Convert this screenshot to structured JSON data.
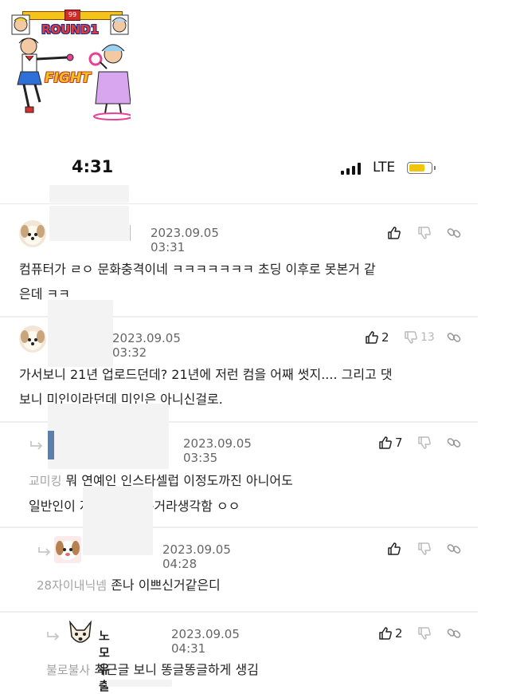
{
  "banner": {
    "round_text": "ROUND1",
    "fight_text": "FIGHT",
    "timer": "99"
  },
  "status_bar": {
    "time": "4:31",
    "network": "LTE"
  },
  "comments": [
    {
      "username": "",
      "date": "2023.09.05 03:31",
      "reply_to": "",
      "text_line1": "컴퓨터가 ㄹㅇ 문화충격이네 ㅋㅋㅋㅋㅋㅋㅋ 초딩 이후로 못본거 같",
      "text_line2": "은데 ㅋㅋ",
      "likes": "",
      "dislikes": ""
    },
    {
      "username": "",
      "date": "2023.09.05 03:32",
      "reply_to": "",
      "text_line1": "가서보니 21년 업로드던데? 21년에 저런 컴을 어째 썻지.... 그리고 댓",
      "text_line2": "보니 미인이라던데 미인은 아니신걸로.",
      "likes": "2",
      "dislikes": "13"
    },
    {
      "username": "",
      "date": "2023.09.05 03:35",
      "reply_to": "교미킹",
      "text_line1": "뭐 연예인 인스타셀럽 이정도까진 아니어도",
      "text_line2": "일반인이 저정도면 예쁜거라생각함 ㅇㅇ",
      "likes": "7",
      "dislikes": ""
    },
    {
      "username": "",
      "date": "2023.09.05 04:28",
      "reply_to": "28자이내닉넴",
      "text_line1": "존나 이쁘신거같은디",
      "text_line2": "",
      "likes": "",
      "dislikes": ""
    },
    {
      "username": "노모유출",
      "date": "2023.09.05 04:31",
      "reply_to": "불로불사",
      "text_line1": "최근글 보니 똥글똥글하게 생김",
      "text_line2": "",
      "likes": "2",
      "dislikes": ""
    }
  ],
  "icons": {
    "like": "thumbs-up-icon",
    "dislike": "thumbs-down-icon",
    "share": "link-icon",
    "reply": "reply-arrow-icon",
    "signal": "signal-bars-icon",
    "battery": "battery-icon"
  },
  "colors": {
    "battery": "#f2c40c",
    "muted": "#a3a3a3",
    "date": "#666666"
  }
}
